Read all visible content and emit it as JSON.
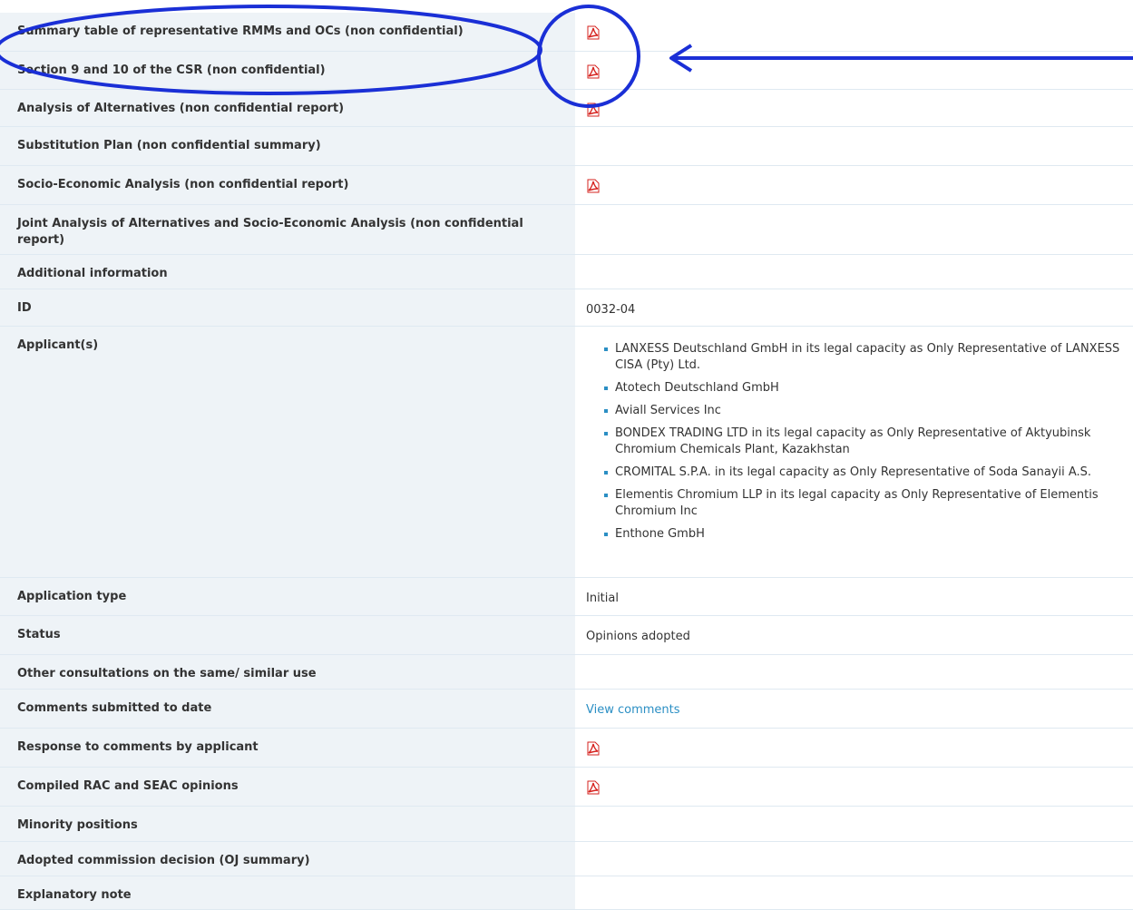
{
  "rows": [
    {
      "label": "Summary table of representative RMMs and OCs (non confidential)",
      "type": "pdf",
      "icon": "pdf-icon"
    },
    {
      "label": "Section 9 and 10 of the CSR (non confidential)",
      "type": "pdf",
      "icon": "pdf-icon"
    },
    {
      "label": "Analysis of Alternatives (non confidential report)",
      "type": "pdf",
      "icon": "pdf-icon"
    },
    {
      "label": "Substitution Plan (non confidential summary)",
      "type": "empty"
    },
    {
      "label": "Socio-Economic Analysis (non confidential report)",
      "type": "pdf",
      "icon": "pdf-icon"
    },
    {
      "label": "Joint Analysis of Alternatives and Socio-Economic Analysis (non confidential report)",
      "type": "empty"
    },
    {
      "label": "Additional information",
      "type": "empty"
    },
    {
      "label": "ID",
      "type": "text",
      "value": "0032-04"
    },
    {
      "label": "Applicant(s)",
      "type": "list",
      "items": [
        "LANXESS Deutschland GmbH in its legal capacity as Only Representative of LANXESS CISA (Pty) Ltd.",
        "Atotech Deutschland GmbH",
        "Aviall Services Inc",
        "BONDEX TRADING LTD in its legal capacity as Only Representative of Aktyubinsk Chromium Chemicals Plant, Kazakhstan",
        "CROMITAL S.P.A. in its legal capacity as Only Representative of Soda Sanayii A.S.",
        "Elementis Chromium LLP in its legal capacity as Only Representative of Elementis Chromium Inc",
        "Enthone GmbH"
      ]
    },
    {
      "label": "Application type",
      "type": "text",
      "value": "Initial"
    },
    {
      "label": "Status",
      "type": "text",
      "value": "Opinions adopted"
    },
    {
      "label": "Other consultations on the same/ similar use",
      "type": "empty"
    },
    {
      "label": "Comments submitted to date",
      "type": "link",
      "value": "View comments"
    },
    {
      "label": "Response to comments by applicant",
      "type": "pdf",
      "icon": "pdf-icon"
    },
    {
      "label": "Compiled RAC and SEAC opinions",
      "type": "pdf",
      "icon": "pdf-icon"
    },
    {
      "label": "Minority positions",
      "type": "empty"
    },
    {
      "label": "Adopted commission decision (OJ summary)",
      "type": "empty"
    },
    {
      "label": "Explanatory note",
      "type": "empty"
    }
  ],
  "colors": {
    "label_bg": "#eef3f7",
    "link": "#2b8fc4",
    "pdf_red": "#d6231f",
    "annotation_blue": "#1a2fd6"
  },
  "annotations": {
    "highlight_ellipse_around": "rows 1-2 labels",
    "highlight_circle_around": "pdf icons rows 1-2",
    "arrow_points_to": "pdf icons rows 1-2"
  }
}
